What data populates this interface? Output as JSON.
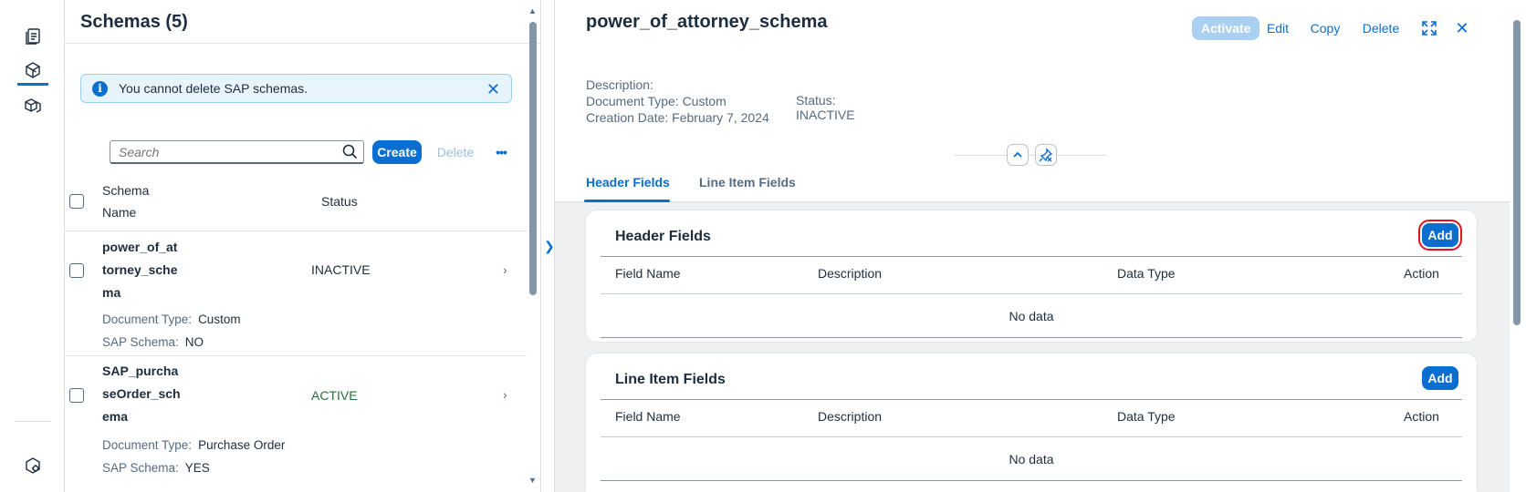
{
  "nav_rail": {
    "items": [
      {
        "icon": "documents-icon"
      },
      {
        "icon": "schema-cube-icon",
        "active": true
      },
      {
        "icon": "cubes-icon"
      }
    ],
    "bottom_icon": "settings-icon"
  },
  "master": {
    "title": "Schemas (5)",
    "message": "You cannot delete SAP schemas.",
    "search_placeholder": "Search",
    "create_label": "Create",
    "delete_label": "Delete",
    "more_label": "•••",
    "columns": {
      "name_line1": "Schema",
      "name_line2": "Name",
      "status": "Status"
    },
    "rows": [
      {
        "name_lines": [
          "power_of_at",
          "torney_sche",
          "ma"
        ],
        "status": "INACTIVE",
        "status_color": "#1d2d3e",
        "doc_type_label": "Document Type:",
        "doc_type": "Custom",
        "sap_label": "SAP Schema:",
        "sap": "NO"
      },
      {
        "name_lines": [
          "SAP_purcha",
          "seOrder_sch",
          "ema"
        ],
        "status": "ACTIVE",
        "status_color": "#256f3a",
        "doc_type_label": "Document Type:",
        "doc_type": "Purchase Order",
        "sap_label": "SAP Schema:",
        "sap": "YES"
      }
    ]
  },
  "detail": {
    "title": "power_of_attorney_schema",
    "actions": {
      "activate": "Activate",
      "edit": "Edit",
      "copy": "Copy",
      "delete": "Delete"
    },
    "description_label": "Description:",
    "description": "",
    "doc_type_text": "Document Type: Custom",
    "creation_text": "Creation Date: February 7, 2024",
    "status_label": "Status:",
    "status": "INACTIVE",
    "tabs": [
      {
        "label": "Header Fields",
        "active": true
      },
      {
        "label": "Line Item Fields",
        "active": false
      }
    ],
    "sections": [
      {
        "title": "Header Fields",
        "add_label": "Add",
        "columns": [
          "Field Name",
          "Description",
          "Data Type",
          "Action"
        ],
        "empty_text": "No data"
      },
      {
        "title": "Line Item Fields",
        "add_label": "Add",
        "columns": [
          "Field Name",
          "Description",
          "Data Type",
          "Action"
        ],
        "empty_text": "No data"
      }
    ]
  },
  "colors": {
    "accent": "#0a6ed1",
    "active_status": "#256f3a",
    "highlight": "#e0141e"
  }
}
